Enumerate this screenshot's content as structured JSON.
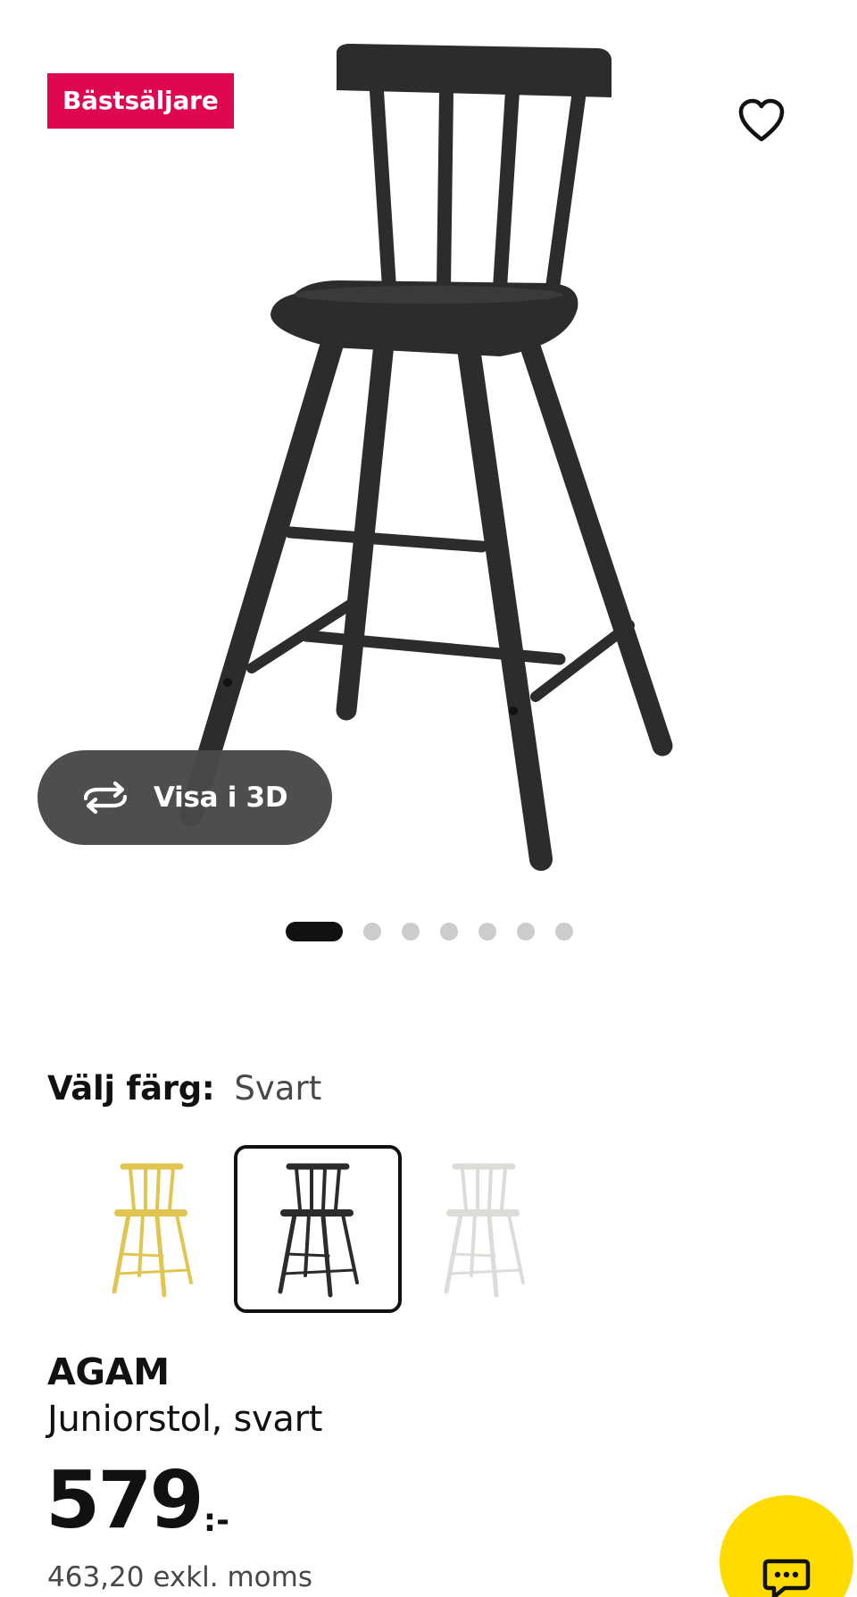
{
  "badge": {
    "label": "Bästsäljare",
    "color": "#e00751"
  },
  "favorite": {
    "icon": "heart-outline-icon"
  },
  "view_3d": {
    "label": "Visa i 3D",
    "icon": "rotate-3d-icon"
  },
  "carousel": {
    "total": 7,
    "active_index": 0
  },
  "color_select": {
    "label": "Välj färg:",
    "selected_value": "Svart",
    "options": [
      {
        "name": "yellow",
        "color": "#e0c552"
      },
      {
        "name": "black",
        "color": "#2b2b2b",
        "selected": true
      },
      {
        "name": "white",
        "color": "#f2f2ef"
      }
    ]
  },
  "product": {
    "name": "AGAM",
    "description": "Juniorstol, svart",
    "price_integer": "579",
    "price_suffix": ":-",
    "price_excl_vat": "463,20 exkl. moms"
  },
  "chat": {
    "icon": "chat-bubble-icon",
    "color": "#ffdb00"
  }
}
